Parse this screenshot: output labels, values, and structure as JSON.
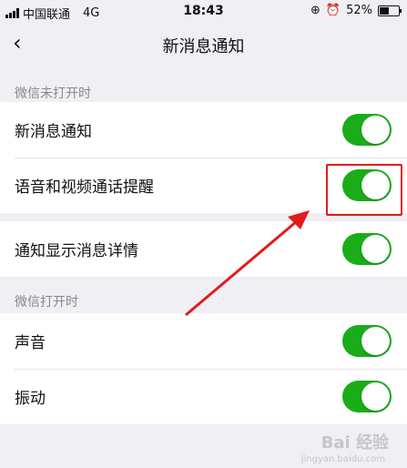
{
  "status_bar": {
    "carrier": "中国联通",
    "network": "4G",
    "time": "18:43",
    "battery": "52%",
    "battery_level": 0.52
  },
  "nav": {
    "title": "新消息通知"
  },
  "sections": [
    {
      "header": "微信未打开时",
      "rows": [
        {
          "label": "新消息通知",
          "on": true
        },
        {
          "label": "语音和视频通话提醒",
          "on": true
        }
      ]
    },
    {
      "header": "",
      "rows": [
        {
          "label": "通知显示消息详情",
          "on": true
        }
      ]
    },
    {
      "header": "微信打开时",
      "rows": [
        {
          "label": "声音",
          "on": true
        },
        {
          "label": "振动",
          "on": true
        }
      ]
    }
  ],
  "watermark": {
    "text": "Bai 经验",
    "sub": "jingyan.baidu.com"
  },
  "colors": {
    "toggle_on": "#1aad19",
    "annotation": "#e21b1b",
    "background": "#efeff4"
  }
}
